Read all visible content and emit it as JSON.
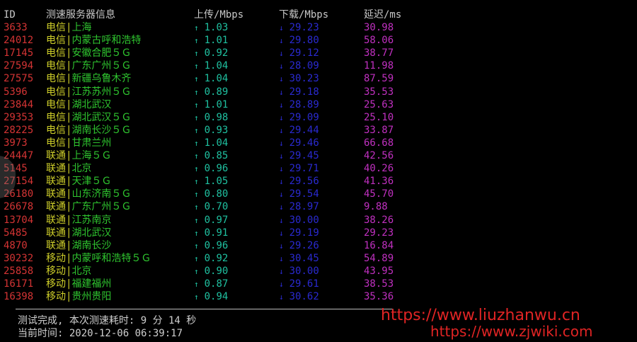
{
  "header": {
    "id": "ID",
    "server": "测速服务器信息",
    "upload": "上传/Mbps",
    "download": "下载/Mbps",
    "latency": "延迟/ms"
  },
  "arrows": {
    "up": "↑",
    "down": "↓"
  },
  "rows": [
    {
      "id": "3633",
      "isp": "电信",
      "city": "上海",
      "up": "1.03",
      "down": "29.23",
      "lat": "30.98"
    },
    {
      "id": "24012",
      "isp": "电信",
      "city": "内蒙古呼和浩特",
      "up": "1.01",
      "down": "29.80",
      "lat": "58.06"
    },
    {
      "id": "17145",
      "isp": "电信",
      "city": "安徽合肥５Ｇ",
      "up": "0.92",
      "down": "29.12",
      "lat": "38.77"
    },
    {
      "id": "27594",
      "isp": "电信",
      "city": "广东广州５Ｇ",
      "up": "1.04",
      "down": "28.09",
      "lat": "11.98"
    },
    {
      "id": "27575",
      "isp": "电信",
      "city": "新疆乌鲁木齐",
      "up": "1.04",
      "down": "30.23",
      "lat": "87.59"
    },
    {
      "id": "5396",
      "isp": "电信",
      "city": "江苏苏州５Ｇ",
      "up": "0.89",
      "down": "29.18",
      "lat": "35.53"
    },
    {
      "id": "23844",
      "isp": "电信",
      "city": "湖北武汉",
      "up": "1.01",
      "down": "28.89",
      "lat": "25.63"
    },
    {
      "id": "29353",
      "isp": "电信",
      "city": "湖北武汉５Ｇ",
      "up": "0.98",
      "down": "29.09",
      "lat": "25.10"
    },
    {
      "id": "28225",
      "isp": "电信",
      "city": "湖南长沙５Ｇ",
      "up": "0.93",
      "down": "29.44",
      "lat": "33.87"
    },
    {
      "id": "3973",
      "isp": "电信",
      "city": "甘肃兰州",
      "up": "1.04",
      "down": "29.46",
      "lat": "66.68"
    },
    {
      "id": "24447",
      "isp": "联通",
      "city": "上海５Ｇ",
      "up": "0.85",
      "down": "29.45",
      "lat": "42.56"
    },
    {
      "id": "5145",
      "isp": "联通",
      "city": "北京",
      "up": "0.96",
      "down": "29.71",
      "lat": "40.26"
    },
    {
      "id": "27154",
      "isp": "联通",
      "city": "天津５Ｇ",
      "up": "1.05",
      "down": "29.56",
      "lat": "41.36"
    },
    {
      "id": "26180",
      "isp": "联通",
      "city": "山东济南５Ｇ",
      "up": "0.80",
      "down": "29.54",
      "lat": "45.70"
    },
    {
      "id": "26678",
      "isp": "联通",
      "city": "广东广州５Ｇ",
      "up": "0.70",
      "down": "28.97",
      "lat": "9.88"
    },
    {
      "id": "13704",
      "isp": "联通",
      "city": "江苏南京",
      "up": "0.97",
      "down": "30.00",
      "lat": "38.26"
    },
    {
      "id": "5485",
      "isp": "联通",
      "city": "湖北武汉",
      "up": "0.91",
      "down": "29.19",
      "lat": "29.23"
    },
    {
      "id": "4870",
      "isp": "联通",
      "city": "湖南长沙",
      "up": "0.96",
      "down": "29.26",
      "lat": "16.84"
    },
    {
      "id": "30232",
      "isp": "移动",
      "city": "内蒙呼和浩特５Ｇ",
      "up": "0.92",
      "down": "30.45",
      "lat": "54.89"
    },
    {
      "id": "25858",
      "isp": "移动",
      "city": "北京",
      "up": "0.90",
      "down": "30.00",
      "lat": "43.95"
    },
    {
      "id": "16171",
      "isp": "移动",
      "city": "福建福州",
      "up": "0.87",
      "down": "29.61",
      "lat": "38.53"
    },
    {
      "id": "16398",
      "isp": "移动",
      "city": "贵州贵阳",
      "up": "0.94",
      "down": "30.62",
      "lat": "35.36"
    }
  ],
  "separator": "|",
  "summary": {
    "elapsed": "测试完成, 本次测速耗时: 9 分 14 秒",
    "current_time": "当前时间: 2020-12-06 06:39:17"
  },
  "watermarks": {
    "line1": "https://www.liuzhanwu.cn",
    "line2": "https://www.zjwiki.com"
  },
  "colors": {
    "id": "#d43434",
    "isp": "#cfcf2a",
    "city": "#2fc62f",
    "upload": "#1fc0a0",
    "download": "#2a2ad0",
    "latency": "#c030c0",
    "watermark": "#e02424"
  }
}
